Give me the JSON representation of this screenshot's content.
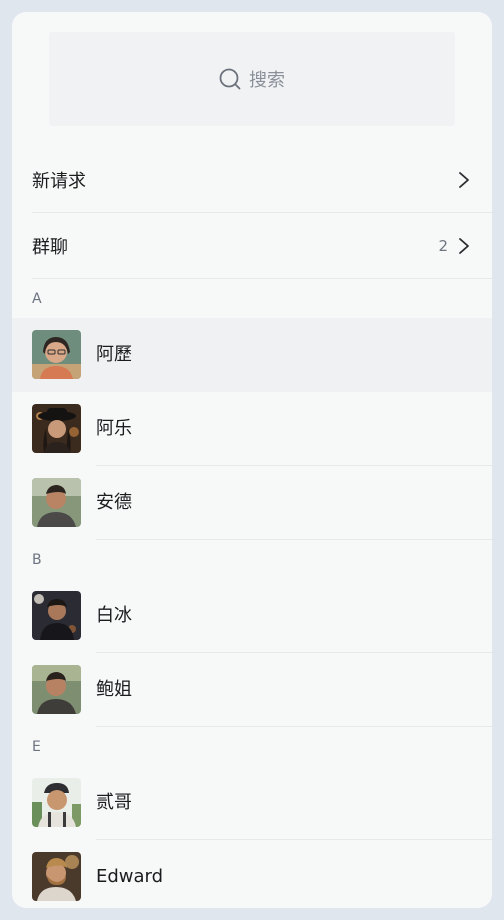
{
  "search": {
    "placeholder": "搜索",
    "icon": "search-icon"
  },
  "menu": [
    {
      "label": "新请求",
      "count": "",
      "icon": "chevron-right-icon"
    },
    {
      "label": "群聊",
      "count": "2",
      "icon": "chevron-right-icon"
    }
  ],
  "sections": [
    {
      "letter": "A",
      "contacts": [
        {
          "name": "阿歷"
        },
        {
          "name": "阿乐"
        },
        {
          "name": "安德"
        }
      ]
    },
    {
      "letter": "B",
      "contacts": [
        {
          "name": "白冰"
        },
        {
          "name": "鲍姐"
        }
      ]
    },
    {
      "letter": "E",
      "contacts": [
        {
          "name": "贰哥"
        },
        {
          "name": "Edward"
        }
      ]
    }
  ],
  "colors": {
    "page_bg": "#f7f8f8",
    "frame_bg": "#dfe6ee",
    "selected_row": "#f0f1f3"
  }
}
